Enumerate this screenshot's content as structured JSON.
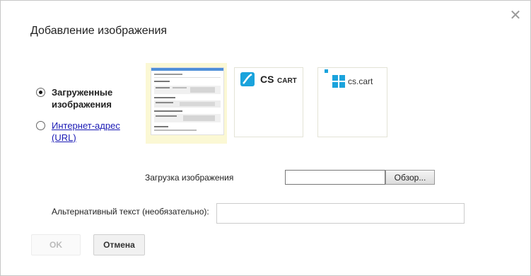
{
  "dialog": {
    "title": "Добавление изображения",
    "close_icon": "close-icon"
  },
  "source_options": [
    {
      "label": "Загруженные изображения",
      "selected": true,
      "style": "bold"
    },
    {
      "label": "Интернет-адрес (URL)",
      "selected": false,
      "style": "link"
    }
  ],
  "thumbnails": [
    {
      "name": "screenshot-thumbnail",
      "selected": true
    },
    {
      "name": "cs-cart-logo-thumbnail",
      "selected": false,
      "logo_text_main": "CS",
      "logo_text_sub": "CART"
    },
    {
      "name": "cs-cart-small-logo-thumbnail",
      "selected": false,
      "logo_text": "cs.cart"
    }
  ],
  "upload": {
    "label": "Загрузка изображения",
    "file_value": "",
    "browse_label": "Обзор..."
  },
  "alt_text": {
    "label": "Альтернативный текст (необязательно):",
    "value": ""
  },
  "buttons": {
    "ok_label": "OK",
    "cancel_label": "Отмена"
  },
  "colors": {
    "selected_thumb_bg": "#fbf8d4",
    "logo_blue": "#1aa3dc",
    "link_blue": "#1a1ab5"
  }
}
